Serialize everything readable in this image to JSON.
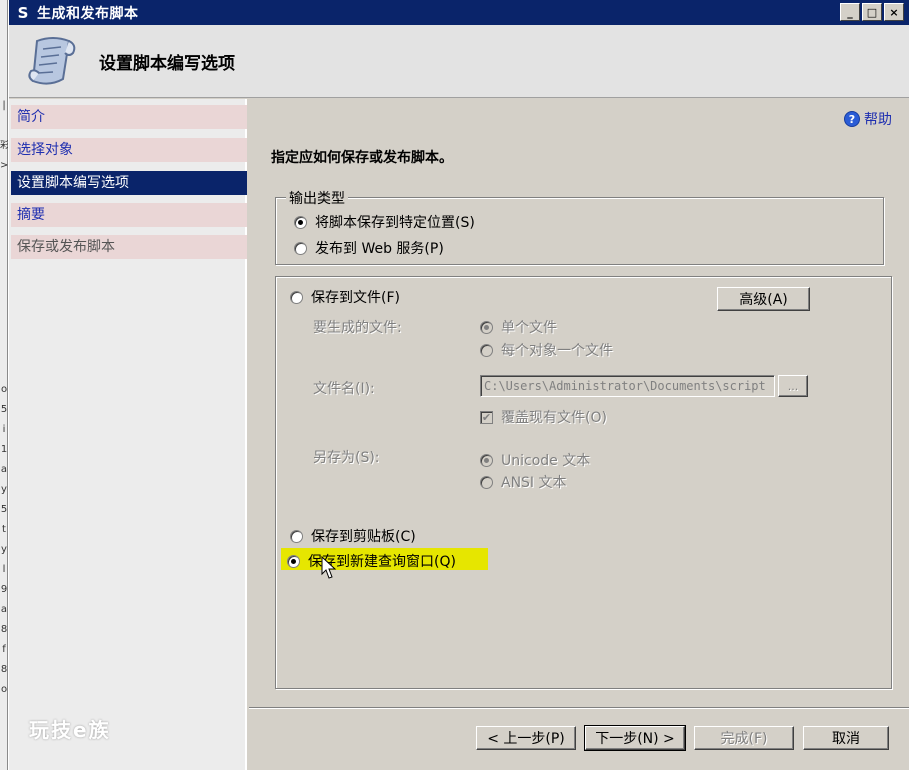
{
  "window": {
    "title": "生成和发布脚本",
    "app_icon": "S",
    "controls": [
      "_",
      "□",
      "×"
    ]
  },
  "header": {
    "heading": "设置脚本编写选项"
  },
  "nav": {
    "items": [
      {
        "label": "简介",
        "state": "link"
      },
      {
        "label": "选择对象",
        "state": "link"
      },
      {
        "label": "设置脚本编写选项",
        "state": "active"
      },
      {
        "label": "摘要",
        "state": "link"
      },
      {
        "label": "保存或发布脚本",
        "state": "disabled"
      }
    ]
  },
  "watermark": "玩技e族",
  "help": {
    "label": "帮助",
    "icon": "help-icon"
  },
  "instruction": "指定应如何保存或发布脚本。",
  "output_type": {
    "legend": "输出类型",
    "options": [
      {
        "label": "将脚本保存到特定位置(S)",
        "checked": true
      },
      {
        "label": "发布到 Web 服务(P)",
        "checked": false
      }
    ]
  },
  "save_options": {
    "save_to_file": {
      "label": "保存到文件(F)",
      "checked": false
    },
    "advanced_button": "高级(A)",
    "files_to_generate": {
      "label": "要生成的文件:",
      "options": [
        {
          "label": "单个文件",
          "checked": true
        },
        {
          "label": "每个对象一个文件",
          "checked": false
        }
      ]
    },
    "file_name": {
      "label": "文件名(I):",
      "value": "C:\\Users\\Administrator\\Documents\\script",
      "browse_label": "..."
    },
    "overwrite": {
      "label": "覆盖现有文件(O)",
      "checked": true
    },
    "save_as": {
      "label": "另存为(S):",
      "options": [
        {
          "label": "Unicode 文本",
          "checked": true
        },
        {
          "label": "ANSI 文本",
          "checked": false
        }
      ]
    },
    "save_to_clipboard": {
      "label": "保存到剪贴板(C)",
      "checked": false
    },
    "save_to_query_window": {
      "label": "保存到新建查询窗口(Q)",
      "checked": true
    }
  },
  "footer": {
    "prev": "< 上一步(P)",
    "next": "下一步(N) >",
    "finish": "完成(F)",
    "cancel": "取消"
  },
  "colors": {
    "titlebar": "#0a246a",
    "nav_active": "#0a246a",
    "link": "#1f2fb0",
    "highlight": "#e6e600"
  }
}
